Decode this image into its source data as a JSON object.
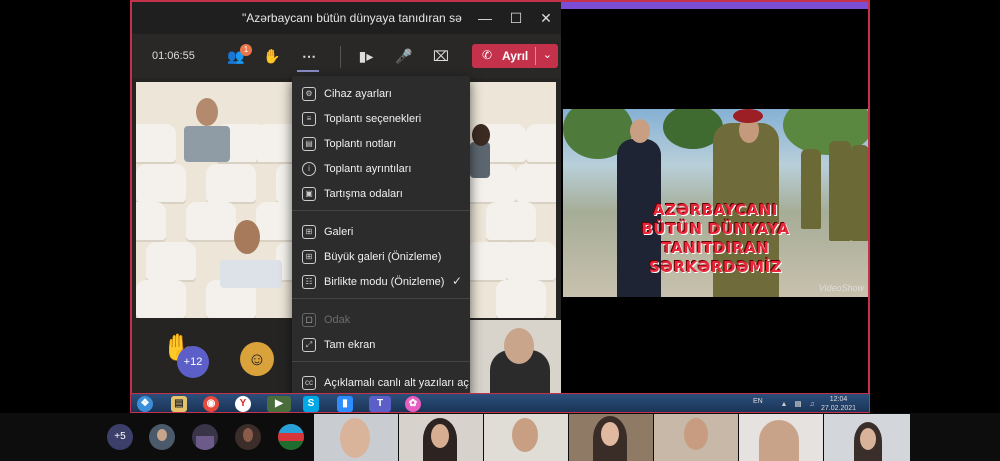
{
  "window": {
    "title": "\"Azərbaycanı bütün dünyaya tanıdıran sə...",
    "minimize_icon": "minimize-icon",
    "maximize_icon": "maximize-icon",
    "close_icon": "close-icon"
  },
  "toolbar": {
    "timer": "01:06:55",
    "participants_badge": "1",
    "leave_label": "Ayrıl"
  },
  "menu": {
    "items": [
      {
        "label": "Cihaz ayarları",
        "icon": "gear-icon",
        "glyph": "⚙"
      },
      {
        "label": "Toplantı seçenekleri",
        "icon": "sliders-icon",
        "glyph": "≡"
      },
      {
        "label": "Toplantı notları",
        "icon": "notes-icon",
        "glyph": "▤"
      },
      {
        "label": "Toplantı ayrıntıları",
        "icon": "info-icon",
        "glyph": "i"
      },
      {
        "label": "Tartışma odaları",
        "icon": "breakout-rooms-icon",
        "glyph": "▣"
      },
      {
        "label": "Galeri",
        "icon": "gallery-icon",
        "glyph": "⊞"
      },
      {
        "label": "Büyük galeri (Önizleme)",
        "icon": "large-gallery-icon",
        "glyph": "⊞"
      },
      {
        "label": "Birlikte modu (Önizleme)",
        "icon": "together-mode-icon",
        "glyph": "☷"
      },
      {
        "label": "Odak",
        "icon": "focus-icon",
        "glyph": "▢"
      },
      {
        "label": "Tam ekran",
        "icon": "fullscreen-icon",
        "glyph": "⤢"
      },
      {
        "label": "Açıklamalı canlı alt yazıları aç",
        "icon": "captions-icon",
        "glyph": "cc"
      }
    ]
  },
  "reactions": {
    "hand_count": "+12"
  },
  "shared_video": {
    "overlay_lines": [
      "AZƏRBAYCANI",
      "BÜTÜN DÜNYAYA",
      "TANITDIRAN",
      "SƏRKƏRDƏMİZ"
    ],
    "watermark": "VideoShow"
  },
  "taskbar": {
    "language": "EN",
    "time": "12:04",
    "date": "27.02.2021"
  },
  "participants_strip": {
    "more_count": "+5"
  }
}
